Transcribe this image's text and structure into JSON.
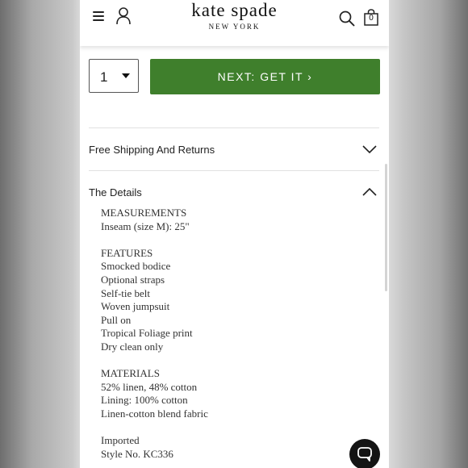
{
  "header": {
    "brand": "kate spade",
    "brand_sub": "NEW YORK",
    "bag_count": "0",
    "icons": [
      "menu-icon",
      "account-icon",
      "search-icon",
      "shopping-bag-icon"
    ]
  },
  "purchase": {
    "quantity": "1",
    "next_button": "NEXT: GET IT ›",
    "button_color": "#3f7f2c"
  },
  "accordions": [
    {
      "label": "Free Shipping And Returns",
      "expanded": false
    },
    {
      "label": "The Details",
      "expanded": true
    }
  ],
  "details": {
    "measurements_heading": "MEASUREMENTS",
    "measurements": [
      "Inseam (size M): 25\""
    ],
    "features_heading": "FEATURES",
    "features": [
      "Smocked bodice",
      "Optional straps",
      "Self-tie belt",
      "Woven jumpsuit",
      "Pull on",
      "Tropical Foliage print",
      "Dry clean only"
    ],
    "materials_heading": "MATERIALS",
    "materials": [
      "52% linen, 48% cotton",
      "Lining: 100% cotton",
      "Linen-cotton blend fabric"
    ],
    "imported": "Imported",
    "style_no": "Style No. KC336"
  }
}
